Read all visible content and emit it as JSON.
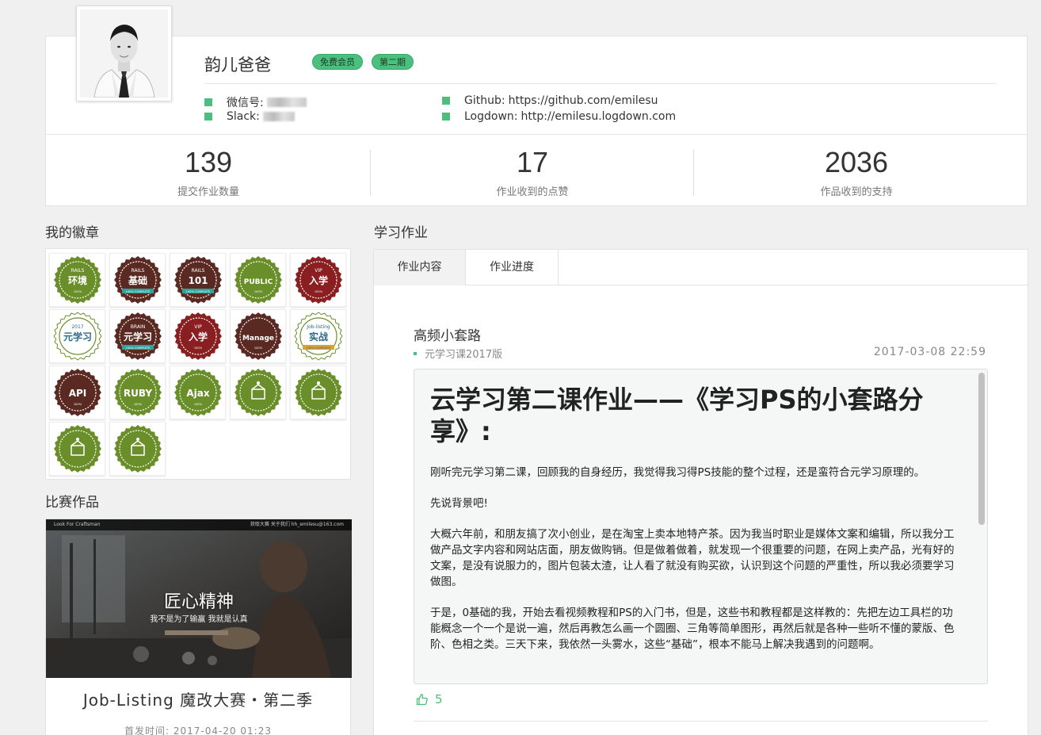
{
  "profile": {
    "name": "韵儿爸爸",
    "badges": [
      "免费会员",
      "第二期"
    ],
    "contacts": {
      "wechat_label": "微信号:",
      "slack_label": "Slack:",
      "github_label": "Github:",
      "github_value": "https://github.com/emilesu",
      "logdown_label": "Logdown:",
      "logdown_value": "http://emilesu.logdown.com"
    },
    "stats": [
      {
        "value": "139",
        "label": "提交作业数量"
      },
      {
        "value": "17",
        "label": "作业收到的点赞"
      },
      {
        "value": "2036",
        "label": "作品收到的支持"
      }
    ]
  },
  "sections": {
    "badges_title": "我的徽章",
    "competition_title": "比赛作品",
    "homework_title": "学习作业"
  },
  "badges": [
    {
      "top": "RAILS",
      "main": "环境",
      "ribbon": "100%",
      "color": "#6a8f2a"
    },
    {
      "top": "RAILS",
      "main": "基础",
      "ribbon": "100% COMPLETE",
      "color": "#5a2a22"
    },
    {
      "top": "RAILS",
      "main": "101",
      "ribbon": "100% COMPLETE",
      "color": "#5a2a22"
    },
    {
      "top": "",
      "main": "PUBLIC",
      "ribbon": "100%",
      "color": "#6a8f2a"
    },
    {
      "top": "VIP",
      "main": "入学",
      "ribbon": "100%",
      "color": "#8a1f22"
    },
    {
      "top": "2017",
      "main": "元学习",
      "ribbon": "",
      "color": "#ffffff"
    },
    {
      "top": "BRAIN",
      "main": "元学习",
      "ribbon": "100% COMPLETE",
      "color": "#5a2a22"
    },
    {
      "top": "VIP",
      "main": "入学",
      "ribbon": "100%",
      "color": "#8a1f22"
    },
    {
      "top": "",
      "main": "Manage",
      "ribbon": "100%",
      "color": "#5a2a22"
    },
    {
      "top": "Job-listing",
      "main": "实战",
      "ribbon": "100% COMPLETE",
      "color": "#ffffff"
    },
    {
      "top": "",
      "main": "API",
      "ribbon": "100%",
      "color": "#5a2a22"
    },
    {
      "top": "",
      "main": "RUBY",
      "ribbon": "100%",
      "color": "#6a8f2a"
    },
    {
      "top": "",
      "main": "Ajax",
      "ribbon": "100%",
      "color": "#6a8f2a"
    },
    {
      "top": "",
      "main": "",
      "ribbon": "",
      "color": "#6a8f2a"
    },
    {
      "top": "",
      "main": "",
      "ribbon": "",
      "color": "#6a8f2a"
    },
    {
      "top": "",
      "main": "",
      "ribbon": "",
      "color": "#6a8f2a"
    },
    {
      "top": "",
      "main": "",
      "ribbon": "",
      "color": "#6a8f2a"
    }
  ],
  "competition": {
    "nav_left": "Look For Craftsman",
    "nav_right": "获取大赛  关于我们  hh_emilesu@163.com",
    "overlay_title": "匠心精神",
    "overlay_sub": "我不是为了输赢 我就是认真",
    "name": "Job-Listing 魔改大赛・第二季",
    "date": "首发时间: 2017-04-20 01:23"
  },
  "homework": {
    "tabs": [
      "作业内容",
      "作业进度"
    ],
    "title": "高频小套路",
    "course": "元学习课2017版",
    "time": "2017-03-08 22:59",
    "article_heading": "云学习第二课作业——《学习PS的小套路分享》:",
    "paragraphs": [
      "刚听完元学习第二课，回顾我的自身经历，我觉得我习得PS技能的整个过程，还是蛮符合元学习原理的。",
      "先说背景吧!",
      "大概六年前，和朋友搞了次小创业，是在淘宝上卖本地特产茶。因为我当时职业是媒体文案和编辑，所以我分工做产品文字内容和网站店面，朋友做购销。但是做着做着，就发现一个很重要的问题，在网上卖产品，光有好的文案，是没有说服力的，图片包装太渣，让人看了就没有购买欲，认识到这个问题的严重性，所以我必须要学习做图。",
      "于是，0基础的我，开始去看视频教程和PS的入门书，但是，这些书和教程都是这样教的：先把左边工具栏的功能概念一个一个是说一遍，然后再教怎么画一个圆圈、三角等简单图形，再然后就是各种一些听不懂的蒙版、色阶、色相之类。三天下来，我依然一头雾水，这些“基础”，根本不能马上解决我遇到的问题啊。"
    ],
    "likes": "5"
  },
  "colors": {
    "accent": "#4bbf7d",
    "background": "#f0f0f0"
  }
}
